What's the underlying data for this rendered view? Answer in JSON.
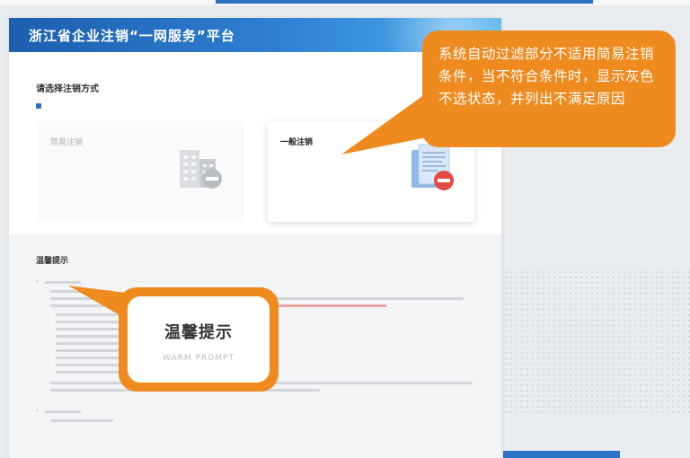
{
  "header": {
    "title": "浙江省企业注销“一网服务”平台"
  },
  "selection": {
    "title": "请选择注销方式",
    "subtitle": "",
    "notice": ""
  },
  "cards": [
    {
      "title": "简易注销",
      "desc": "",
      "link": ""
    },
    {
      "title": "一般注销",
      "desc": "",
      "link": ""
    }
  ],
  "prompt_section": {
    "title": "温馨提示",
    "subtitle": ""
  },
  "callouts": {
    "filter": "系统自动过滤部分不适用简易注销条件，当不符合条件时，显示灰色不选状态，并列出不满足原因",
    "warm_title_cn": "温馨提示",
    "warm_title_en": "WARM PROMPT"
  },
  "colors": {
    "header_blue": "#1c5fae",
    "accent_blue": "#2a73c7",
    "callout_orange": "#ef8a1f"
  }
}
